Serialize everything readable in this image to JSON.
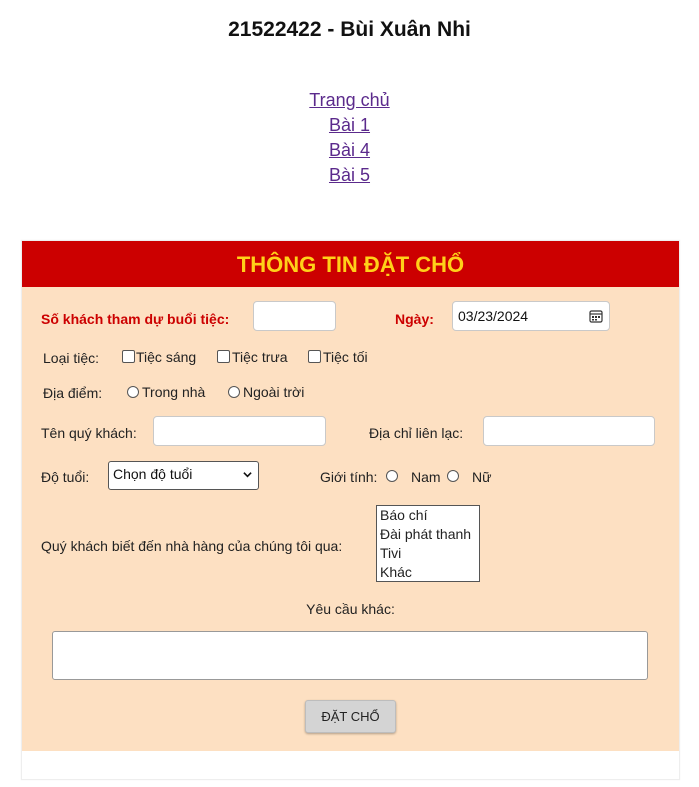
{
  "header": {
    "title": "21522422 - Bùi Xuân Nhi"
  },
  "nav": {
    "items": [
      "Trang chủ",
      "Bài 1",
      "Bài 4",
      "Bài 5"
    ]
  },
  "form": {
    "title": "THÔNG TIN ĐẶT CHỔ",
    "guests_label": "Số khách tham dự buổi tiệc:",
    "guests_value": "",
    "date_label": "Ngày:",
    "date_value": "03/23/2024",
    "party_type_label": "Loại tiệc:",
    "party_types": [
      "Tiệc sáng",
      "Tiệc trưa",
      "Tiệc tối"
    ],
    "location_label": "Địa điểm:",
    "locations": [
      "Trong nhà",
      "Ngoài trời"
    ],
    "name_label": "Tên quý khách:",
    "name_value": "",
    "contact_label": "Địa chỉ liên lạc:",
    "contact_value": "",
    "age_label": "Độ tuổi:",
    "age_selected": "Chọn độ tuổi",
    "gender_label": "Giới tính:",
    "genders": [
      "Nam",
      "Nữ"
    ],
    "source_label": "Quý khách biết đến nhà hàng của chúng tôi qua:",
    "source_options": [
      "Báo chí",
      "Đài phát thanh",
      "Tivi",
      "Khác"
    ],
    "other_request_label": "Yêu cầu khác:",
    "other_request_value": "",
    "submit_label": "ĐẶT CHỔ"
  }
}
